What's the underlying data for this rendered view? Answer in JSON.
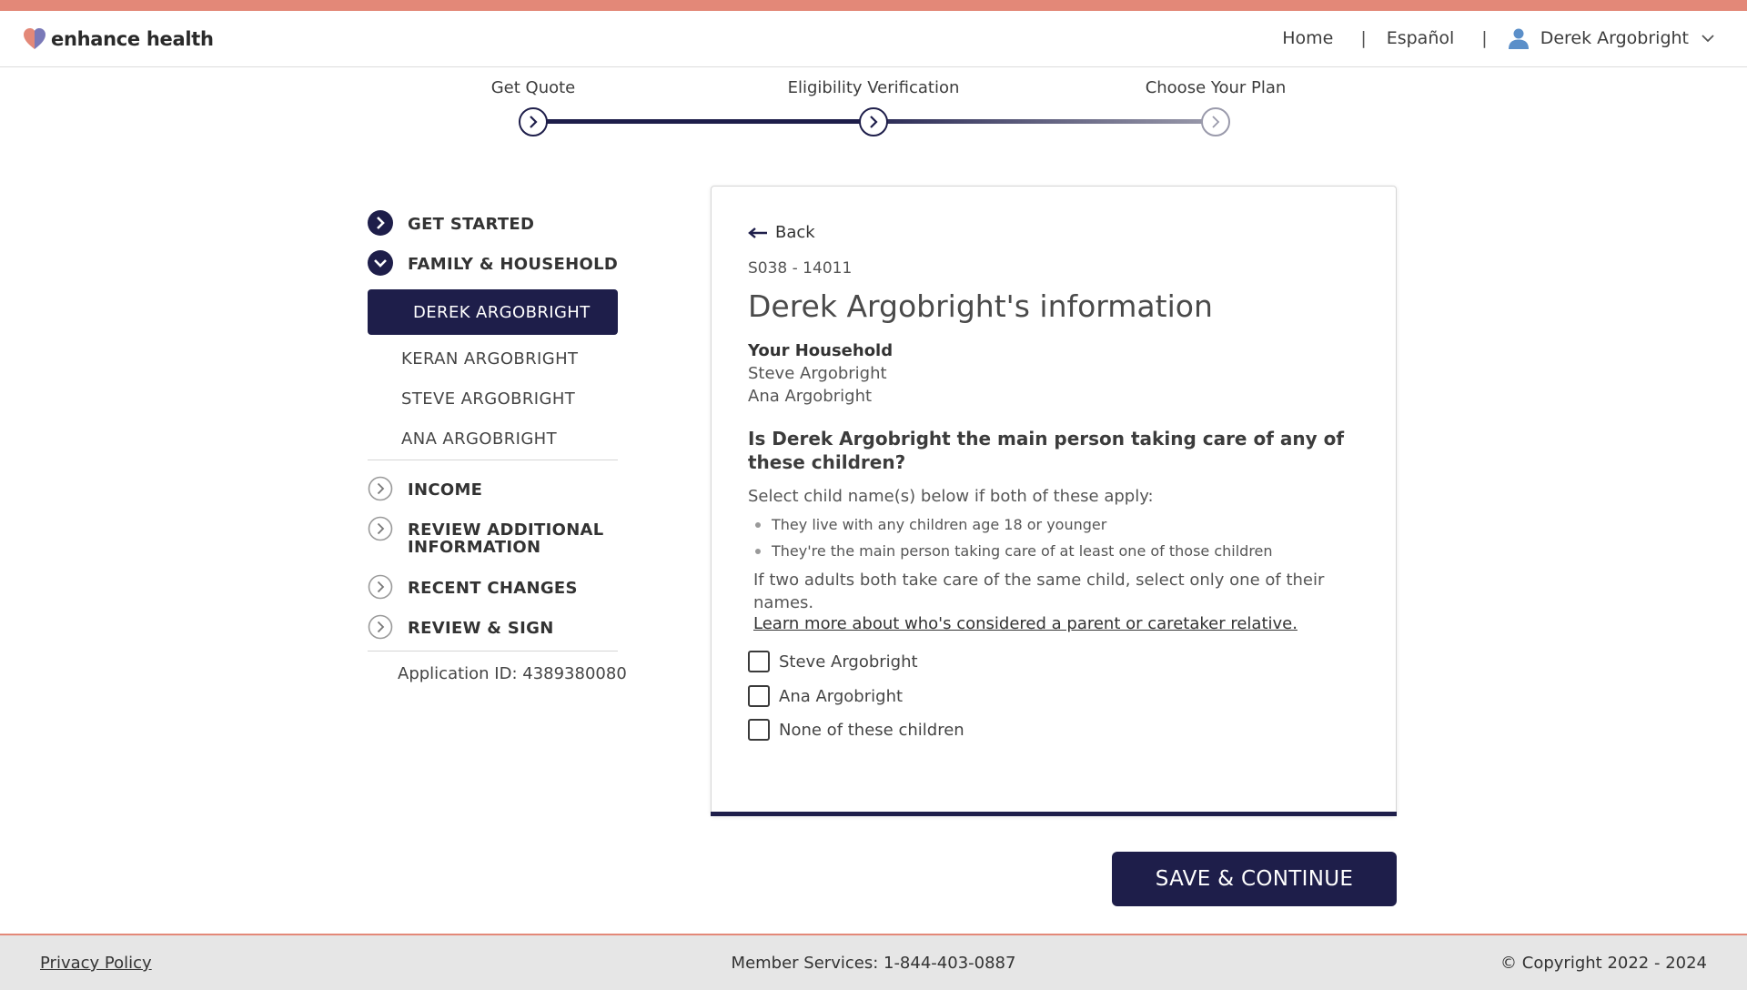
{
  "brand": {
    "name": "enhance health"
  },
  "nav": {
    "home": "Home",
    "spanish": "Español",
    "separator": "|",
    "user_name": "Derek Argobright"
  },
  "stepper": {
    "steps": [
      {
        "label": "Get Quote",
        "state": "complete"
      },
      {
        "label": "Eligibility Verification",
        "state": "current"
      },
      {
        "label": "Choose Your Plan",
        "state": "upcoming"
      }
    ]
  },
  "sidebar": {
    "sections": [
      {
        "label": "GET STARTED",
        "state": "complete"
      },
      {
        "label": "FAMILY & HOUSEHOLD",
        "state": "expanded"
      },
      {
        "label": "INCOME",
        "state": "upcoming"
      },
      {
        "label": "REVIEW ADDITIONAL INFORMATION",
        "state": "upcoming"
      },
      {
        "label": "RECENT CHANGES",
        "state": "upcoming"
      },
      {
        "label": "REVIEW & SIGN",
        "state": "upcoming"
      }
    ],
    "members": [
      {
        "label": "DEREK ARGOBRIGHT",
        "active": true
      },
      {
        "label": "KERAN ARGOBRIGHT",
        "active": false
      },
      {
        "label": "STEVE ARGOBRIGHT",
        "active": false
      },
      {
        "label": "ANA ARGOBRIGHT",
        "active": false
      }
    ],
    "application_id": "Application ID: 4389380080"
  },
  "card": {
    "back": "Back",
    "code": "S038 - 14011",
    "title": "Derek Argobright's information",
    "household_label": "Your Household",
    "household_members": [
      "Steve Argobright",
      "Ana Argobright"
    ],
    "question": "Is Derek Argobright the main person taking care of any of these children?",
    "instruction": "Select child name(s) below if both of these apply:",
    "bullets": [
      "They live with any children age 18 or younger",
      "They're the main person taking care of at least one of those children"
    ],
    "note": "If two adults both take care of the same child, select only one of their names.",
    "learn_more": "Learn more about who's considered a parent or caretaker relative.",
    "options": [
      {
        "label": "Steve Argobright",
        "checked": false
      },
      {
        "label": "Ana Argobright",
        "checked": false
      },
      {
        "label": "None of these children",
        "checked": false
      }
    ]
  },
  "actions": {
    "save": "SAVE & CONTINUE"
  },
  "footer": {
    "privacy": "Privacy Policy",
    "phone": "Member Services: 1-844-403-0887",
    "copyright": "© Copyright 2022 - 2024"
  },
  "colors": {
    "accent_bar": "#e38878",
    "navy": "#1e1e4a",
    "footer_bg": "#e6e6e6",
    "icon_blue": "#5b8fc9"
  }
}
